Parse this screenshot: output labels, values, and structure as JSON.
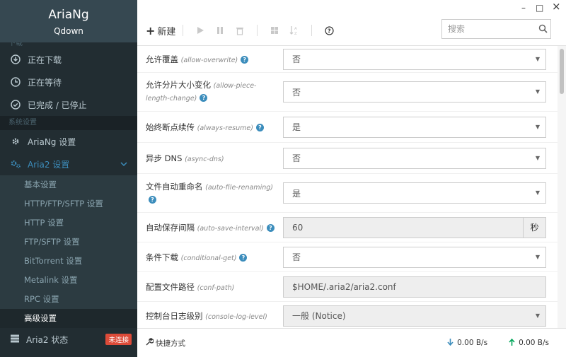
{
  "brand": {
    "title": "AriaNg",
    "subtitle": "Qdown"
  },
  "sidebar": {
    "cut_header": "下载",
    "downloads": [
      {
        "label": "正在下载",
        "icon": "download-icon"
      },
      {
        "label": "正在等待",
        "icon": "clock-icon"
      },
      {
        "label": "已完成 / 已停止",
        "icon": "check-circle-icon"
      }
    ],
    "settings_header": "系统设置",
    "ariang_settings": "AriaNg 设置",
    "aria2_settings": "Aria2 设置",
    "sub_items": [
      "基本设置",
      "HTTP/FTP/SFTP 设置",
      "HTTP 设置",
      "FTP/SFTP 设置",
      "BitTorrent 设置",
      "Metalink 设置",
      "RPC 设置",
      "高级设置"
    ],
    "aria2_status": "Aria2 状态",
    "status_badge": "未连接"
  },
  "toolbar": {
    "new_label": "新建",
    "search_placeholder": "搜索"
  },
  "window": {
    "minimize": "–",
    "maximize": "□",
    "close": "×"
  },
  "settings": [
    {
      "label": "允许覆盖",
      "key": "(allow-overwrite)",
      "type": "select",
      "value": "否"
    },
    {
      "label": "允许分片大小变化",
      "key": "(allow-piece-length-change)",
      "type": "select",
      "value": "否"
    },
    {
      "label": "始终断点续传",
      "key": "(always-resume)",
      "type": "select",
      "value": "是"
    },
    {
      "label": "异步 DNS",
      "key": "(async-dns)",
      "type": "select",
      "value": "否"
    },
    {
      "label": "文件自动重命名",
      "key": "(auto-file-renaming)",
      "type": "select",
      "value": "是"
    },
    {
      "label": "自动保存间隔",
      "key": "(auto-save-interval)",
      "type": "input-addon",
      "value": "60",
      "addon": "秒"
    },
    {
      "label": "条件下载",
      "key": "(conditional-get)",
      "type": "select",
      "value": "否"
    },
    {
      "label": "配置文件路径",
      "key": "(conf-path)",
      "type": "input",
      "value": "$HOME/.aria2/aria2.conf"
    },
    {
      "label": "控制台日志级别",
      "key": "(console-log-level)",
      "type": "select-disabled",
      "value": "一般 (Notice)"
    }
  ],
  "footer": {
    "shortcut": "快捷方式",
    "download_speed": "0.00 B/s",
    "upload_speed": "0.00 B/s"
  },
  "colors": {
    "sidebar_bg": "#222d32",
    "brand_bg": "#364851",
    "accent": "#3c8dbc",
    "badge": "#dd4b39"
  }
}
